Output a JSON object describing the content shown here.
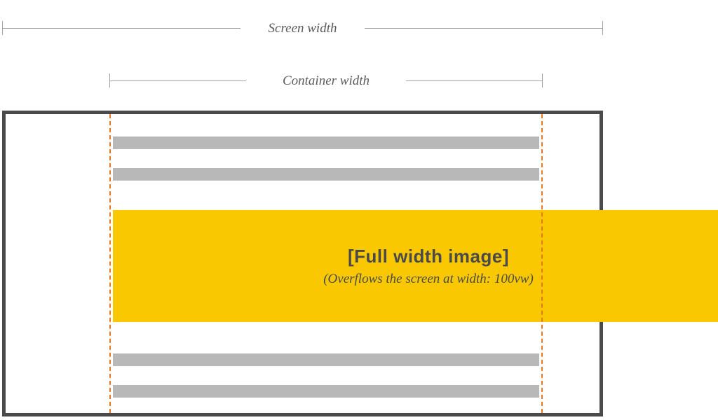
{
  "labels": {
    "screen_width": "Screen width",
    "container_width": "Container width"
  },
  "full_width": {
    "title": "[Full width image]",
    "subtitle": "(Overflows the screen at width: 100vw)"
  }
}
